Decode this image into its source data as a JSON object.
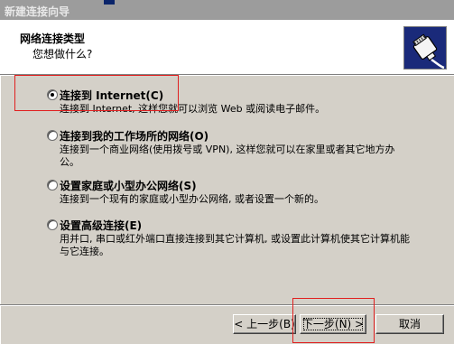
{
  "window": {
    "title": "新建连接向导"
  },
  "header": {
    "title": "网络连接类型",
    "subtitle": "您想做什么?",
    "icon": "network-connection-icon"
  },
  "options": [
    {
      "label": "连接到 Internet(C)",
      "desc": "连接到 Internet, 这样您就可以浏览 Web 或阅读电子邮件。",
      "checked": true
    },
    {
      "label": "连接到我的工作场所的网络(O)",
      "desc": "连接到一个商业网络(使用拨号或 VPN), 这样您就可以在家里或者其它地方办公。",
      "checked": false
    },
    {
      "label": "设置家庭或小型办公网络(S)",
      "desc": "连接到一个现有的家庭或小型办公网络, 或者设置一个新的。",
      "checked": false
    },
    {
      "label": "设置高级连接(E)",
      "desc": "用并口, 串口或红外端口直接连接到其它计算机, 或设置此计算机使其它计算机能与它连接。",
      "checked": false
    }
  ],
  "buttons": {
    "back": "< 上一步(B)",
    "next": "下一步(N) >",
    "cancel": "取消"
  },
  "colors": {
    "annotation": "#e02020",
    "header_icon_bg": "#000a4a"
  }
}
